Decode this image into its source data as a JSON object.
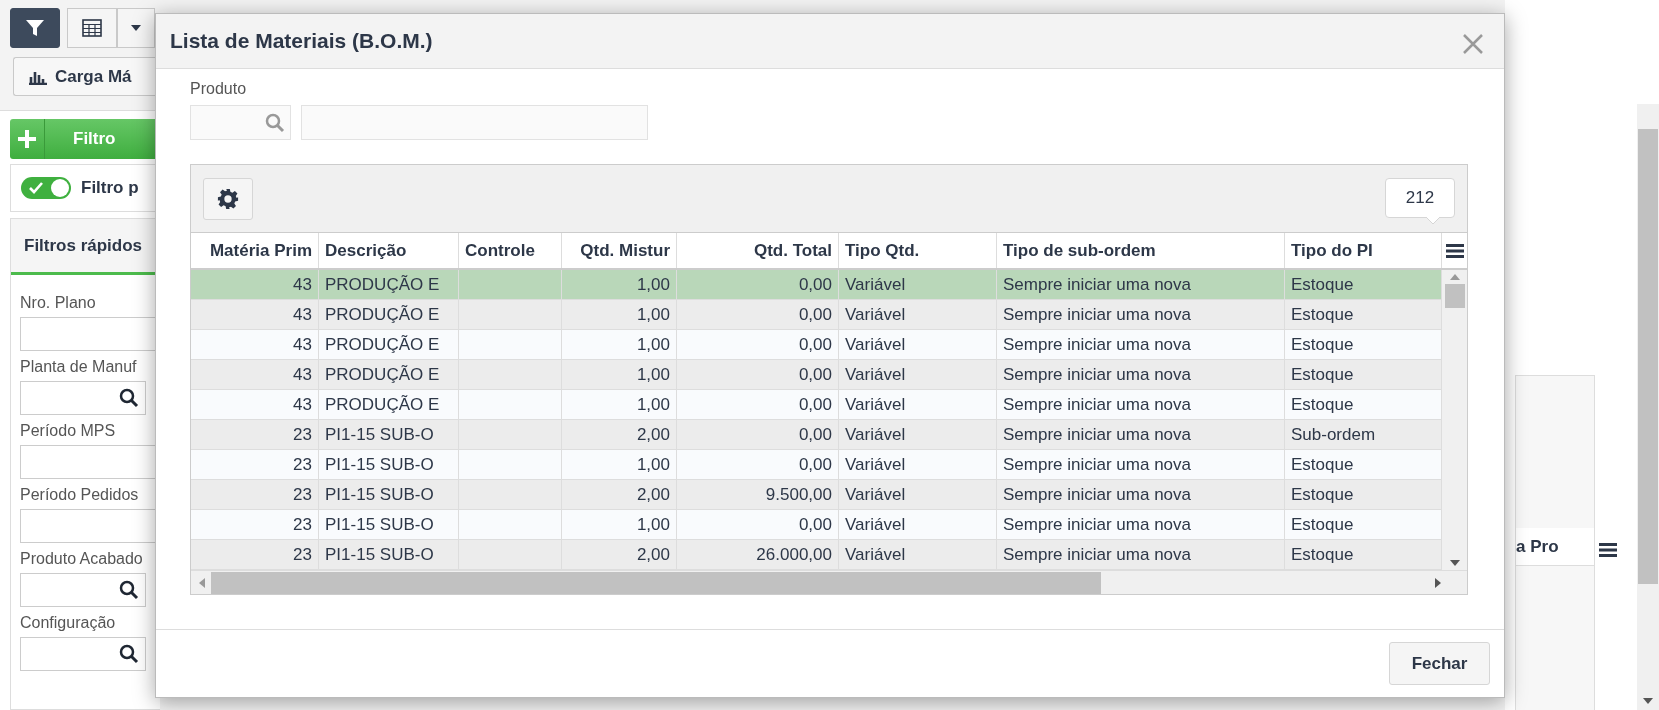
{
  "toolbar": {
    "buttons": [
      {
        "kind": "filter",
        "selected": true
      },
      {
        "kind": "table",
        "selected": false
      },
      {
        "kind": "caret",
        "selected": false
      }
    ]
  },
  "chart_button": {
    "label": "Carga Má"
  },
  "filter_button": {
    "label": "Filtro"
  },
  "filter_toggle": {
    "label": "Filtro p",
    "on": true
  },
  "quick_filters": {
    "title": "Filtros rápidos",
    "fields": [
      {
        "label": "Nro. Plano",
        "kind": "text"
      },
      {
        "label": "Planta de Manuf",
        "kind": "lookup"
      },
      {
        "label": "Período MPS",
        "kind": "text"
      },
      {
        "label": "Período Pedidos",
        "kind": "text"
      },
      {
        "label": "Produto Acabado",
        "kind": "lookup"
      },
      {
        "label": "Configuração",
        "kind": "lookup"
      }
    ]
  },
  "background_grid": {
    "column_header": "a Pro"
  },
  "dialog": {
    "title": "Lista de Materiais (B.O.M.)",
    "product": {
      "label": "Produto"
    },
    "grid": {
      "count": "212",
      "columns": [
        {
          "label": "Matéria Prim",
          "kind": "number"
        },
        {
          "label": "Descrição",
          "kind": "text"
        },
        {
          "label": "Controle",
          "kind": "text"
        },
        {
          "label": "Qtd. Mistur",
          "kind": "number"
        },
        {
          "label": "Qtd. Total",
          "kind": "number"
        },
        {
          "label": "Tipo Qtd.",
          "kind": "text"
        },
        {
          "label": "Tipo de sub-ordem",
          "kind": "text"
        },
        {
          "label": "Tipo do PI",
          "kind": "text"
        }
      ],
      "rows": [
        {
          "selected": true,
          "cells": [
            "43",
            "PRODUÇÃO E",
            null,
            "1,00",
            "0,00",
            "Variável",
            "Sempre iniciar uma nova",
            "Estoque"
          ]
        },
        {
          "selected": false,
          "cells": [
            "43",
            "PRODUÇÃO E",
            null,
            "1,00",
            "0,00",
            "Variável",
            "Sempre iniciar uma nova",
            "Estoque"
          ]
        },
        {
          "selected": false,
          "cells": [
            "43",
            "PRODUÇÃO E",
            null,
            "1,00",
            "0,00",
            "Variável",
            "Sempre iniciar uma nova",
            "Estoque"
          ]
        },
        {
          "selected": false,
          "cells": [
            "43",
            "PRODUÇÃO E",
            null,
            "1,00",
            "0,00",
            "Variável",
            "Sempre iniciar uma nova",
            "Estoque"
          ]
        },
        {
          "selected": false,
          "cells": [
            "43",
            "PRODUÇÃO E",
            null,
            "1,00",
            "0,00",
            "Variável",
            "Sempre iniciar uma nova",
            "Estoque"
          ]
        },
        {
          "selected": false,
          "cells": [
            "23",
            "PI1-15 SUB-O",
            null,
            "2,00",
            "0,00",
            "Variável",
            "Sempre iniciar uma nova",
            "Sub-ordem"
          ]
        },
        {
          "selected": false,
          "cells": [
            "23",
            "PI1-15 SUB-O",
            null,
            "1,00",
            "0,00",
            "Variável",
            "Sempre iniciar uma nova",
            "Estoque"
          ]
        },
        {
          "selected": false,
          "cells": [
            "23",
            "PI1-15 SUB-O",
            null,
            "2,00",
            "9.500,00",
            "Variável",
            "Sempre iniciar uma nova",
            "Estoque"
          ]
        },
        {
          "selected": false,
          "cells": [
            "23",
            "PI1-15 SUB-O",
            null,
            "1,00",
            "0,00",
            "Variável",
            "Sempre iniciar uma nova",
            "Estoque"
          ]
        },
        {
          "selected": false,
          "cells": [
            "23",
            "PI1-15 SUB-O",
            null,
            "2,00",
            "26.000,00",
            "Variável",
            "Sempre iniciar uma nova",
            "Estoque"
          ]
        }
      ]
    },
    "buttons": [
      "Fechar"
    ]
  }
}
